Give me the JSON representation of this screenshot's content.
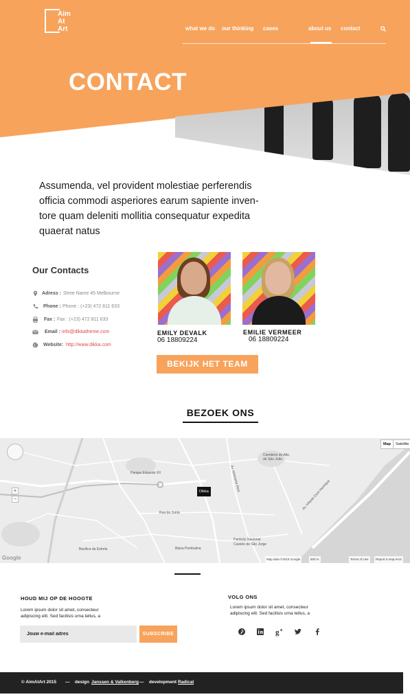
{
  "brand": {
    "logo_lines": [
      "Aim",
      "At",
      "Art"
    ],
    "accent": "#f7a35c"
  },
  "nav": {
    "items": [
      "what we do",
      "our thinking",
      "cases",
      "about us",
      "contact"
    ],
    "active": "about us"
  },
  "hero": {
    "title": "CONTACT"
  },
  "intro": "Assumenda, vel provident molestiae perferendis officia commodi asperiores earum sapiente inven-tore quam deleniti mollitia consequatur expedita quaerat natus",
  "contacts": {
    "title": "Our Contacts",
    "rows": [
      {
        "icon": "location-pin-icon",
        "label": "Adress :",
        "value": "Stree Name 45 Melbourne"
      },
      {
        "icon": "phone-icon",
        "label": "Phone :",
        "value": "Phone : (+23) 472 811 633"
      },
      {
        "icon": "fax-icon",
        "label": "Fax :",
        "value": "Fax : (+23) 472 811 633"
      },
      {
        "icon": "envelope-icon",
        "label": "Email :",
        "value": "info@dikkatheme.com"
      },
      {
        "icon": "globe-icon",
        "label": "Website:",
        "value": "http://www.dikka.com"
      }
    ]
  },
  "team": [
    {
      "name": "EMILY DEVALK",
      "phone": "06 18809224"
    },
    {
      "name": "EMILIE VERMEER",
      "phone": "06 18809224"
    }
  ],
  "team_button": "BEKIJK HET TEAM",
  "visit": {
    "title": "BEZOEK ONS",
    "map": {
      "type_buttons": [
        "Map",
        "Satellite"
      ],
      "marker": "Dikka",
      "labels": [
        "Parque Eduardo VII",
        "Cemitério do Alto de São João",
        "Rua da Junta",
        "Basílica da Estrela",
        "Baixa Pombalina",
        "Panteão Nacional",
        "Castelo de São Jorge",
        "Av. Almirante Reis",
        "Av. Infante Dom Henrique"
      ],
      "attribution": [
        "Map data ©2015 Google",
        "500 m",
        "Terms of Use",
        "Report a map error"
      ],
      "google": "Google"
    }
  },
  "newsletter": {
    "title": "HOUD MIJ OP DE HOOGTE",
    "text": "Lorem ipsum dolor sit amet, consecteur adipiscing elit. Sed facilisis urna tellus, a",
    "placeholder": "Jouw e-mail adres",
    "button": "SUBSCRIBE"
  },
  "follow": {
    "title": "VOLG ONS",
    "text": "Lorem ipsum dolor sit amet, consecteur adipiscing elit. Sed facilisis urna tellus, a",
    "icons": [
      "pinterest-icon",
      "linkedin-icon",
      "google-plus-icon",
      "twitter-icon",
      "facebook-icon"
    ]
  },
  "footer": {
    "copyright": "© AimAtArt 2015",
    "sep": "—",
    "design_label": "design",
    "design_value": "Janssen & Valkenberg",
    "dev_label": "development",
    "dev_value": "Radical"
  }
}
